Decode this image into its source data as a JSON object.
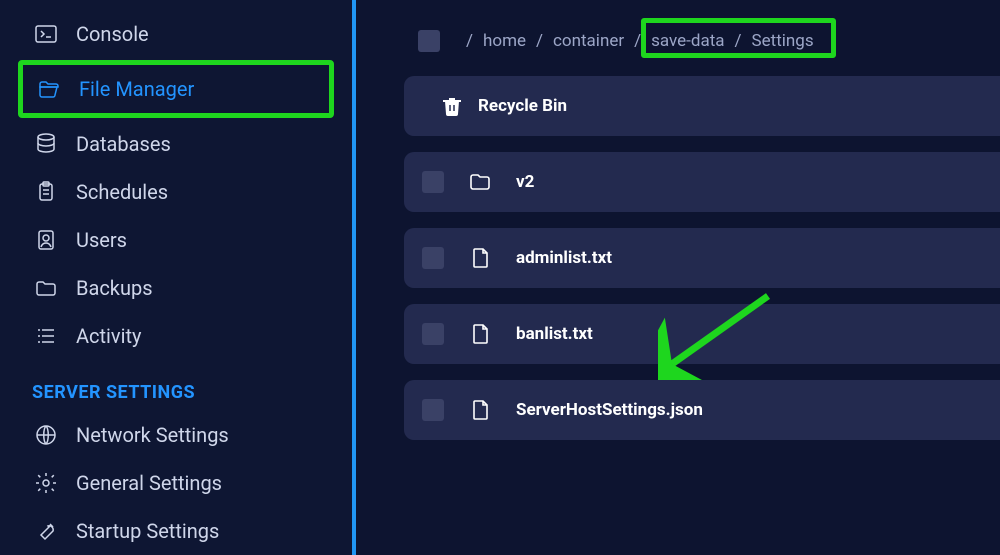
{
  "sidebar": {
    "nav": [
      {
        "id": "console",
        "label": "Console"
      },
      {
        "id": "file-manager",
        "label": "File Manager",
        "active": true,
        "highlighted": true
      },
      {
        "id": "databases",
        "label": "Databases"
      },
      {
        "id": "schedules",
        "label": "Schedules"
      },
      {
        "id": "users",
        "label": "Users"
      },
      {
        "id": "backups",
        "label": "Backups"
      },
      {
        "id": "activity",
        "label": "Activity"
      }
    ],
    "section_label": "SERVER SETTINGS",
    "settings": [
      {
        "id": "network-settings",
        "label": "Network Settings"
      },
      {
        "id": "general-settings",
        "label": "General Settings"
      },
      {
        "id": "startup-settings",
        "label": "Startup Settings"
      }
    ]
  },
  "breadcrumbs": {
    "segments": [
      "/",
      "home",
      "/",
      "container",
      "/",
      "save-data",
      "/",
      "Settings"
    ]
  },
  "files": {
    "recycle_label": "Recycle Bin",
    "rows": [
      {
        "type": "folder",
        "name": "v2"
      },
      {
        "type": "file",
        "name": "adminlist.txt"
      },
      {
        "type": "file",
        "name": "banlist.txt",
        "pointed": true
      },
      {
        "type": "file",
        "name": "ServerHostSettings.json"
      }
    ]
  },
  "annotation": {
    "highlight_color": "#1ed61e",
    "arrow_color": "#1ed61e"
  }
}
